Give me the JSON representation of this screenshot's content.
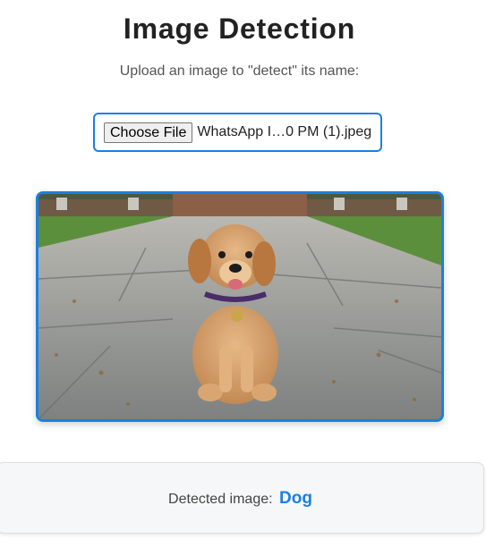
{
  "page": {
    "title": "Image Detection",
    "subtitle": "Upload an image to \"detect\" its name:"
  },
  "upload": {
    "button_label": "Choose File",
    "file_name": "WhatsApp I…0 PM (1).jpeg"
  },
  "preview": {
    "icon": "uploaded-photo",
    "description_hidden": true
  },
  "result": {
    "label": "Detected image:",
    "value": "Dog"
  },
  "colors": {
    "accent": "#1a7fe6",
    "title": "#222222",
    "subtitle": "#555555",
    "card_background": "#f6f7f8"
  }
}
